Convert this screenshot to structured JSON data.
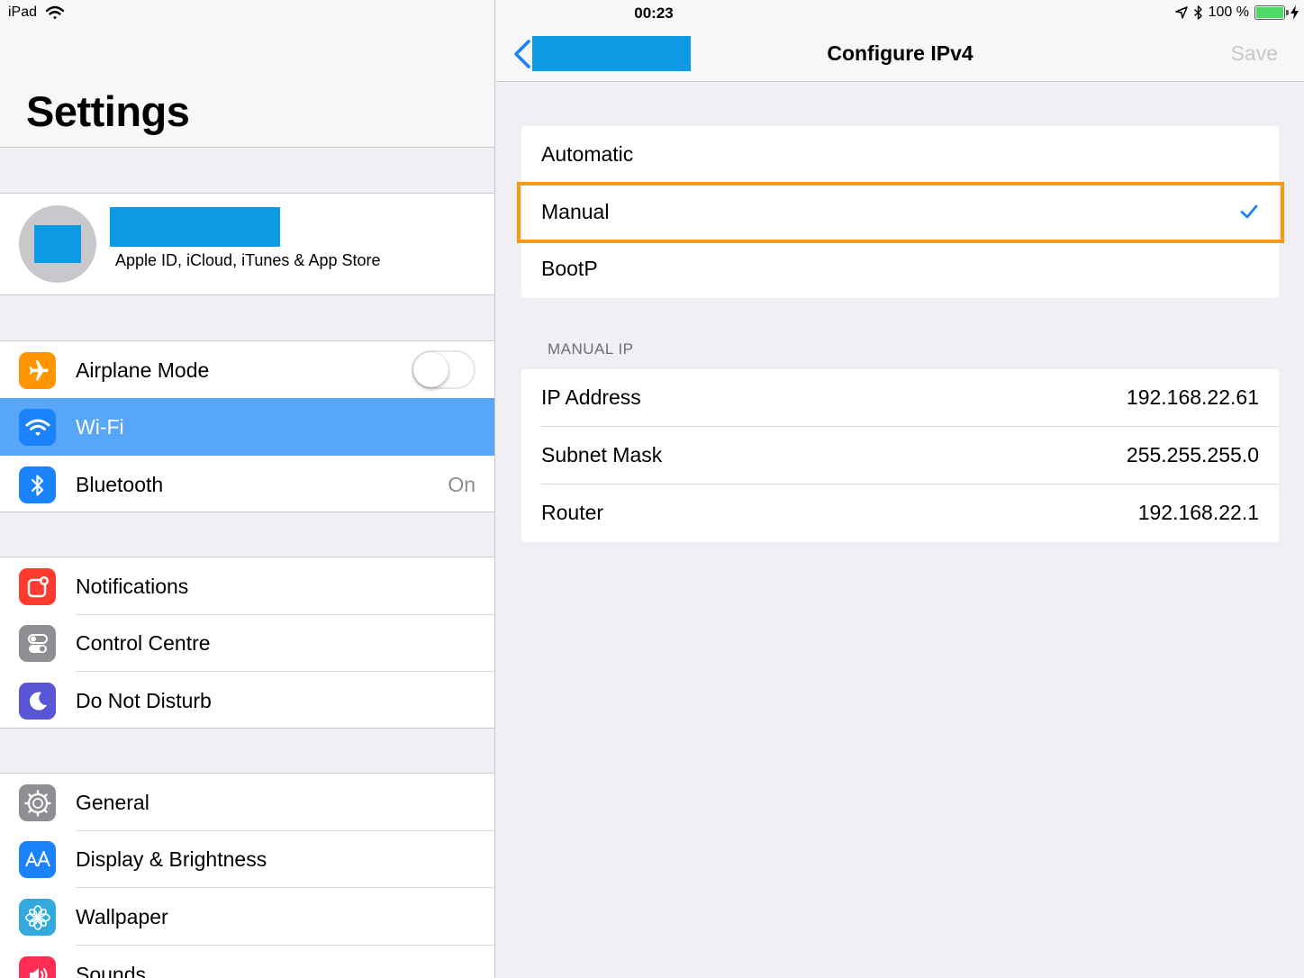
{
  "status_bar": {
    "device": "iPad",
    "time": "00:23",
    "battery": "100 %"
  },
  "sidebar": {
    "title": "Settings",
    "profile": {
      "subtitle": "Apple ID, iCloud, iTunes & App Store"
    },
    "items": [
      {
        "label": "Airplane Mode",
        "icon": "airplane-icon",
        "color": "#ff9500",
        "toggle": false
      },
      {
        "label": "Wi-Fi",
        "icon": "wifi-icon",
        "color": "#1a82fb",
        "selected": true
      },
      {
        "label": "Bluetooth",
        "icon": "bluetooth-icon",
        "color": "#1a82fb",
        "value": "On"
      },
      {
        "label": "Notifications",
        "icon": "notifications-icon",
        "color": "#ff3b30"
      },
      {
        "label": "Control Centre",
        "icon": "control-centre-icon",
        "color": "#8e8e93"
      },
      {
        "label": "Do Not Disturb",
        "icon": "moon-icon",
        "color": "#5856d6"
      },
      {
        "label": "General",
        "icon": "gear-icon",
        "color": "#8e8e93"
      },
      {
        "label": "Display & Brightness",
        "icon": "display-icon",
        "color": "#1a82fb"
      },
      {
        "label": "Wallpaper",
        "icon": "wallpaper-icon",
        "color": "#34aadc"
      },
      {
        "label": "Sounds",
        "icon": "sounds-icon",
        "color": "#ff2d55"
      }
    ]
  },
  "detail": {
    "nav_title": "Configure IPv4",
    "save_label": "Save",
    "options": [
      "Automatic",
      "Manual",
      "BootP"
    ],
    "selected_option": "Manual",
    "manual_section_header": "MANUAL IP",
    "fields": [
      {
        "label": "IP Address",
        "value": "192.168.22.61"
      },
      {
        "label": "Subnet Mask",
        "value": "255.255.255.0"
      },
      {
        "label": "Router",
        "value": "192.168.22.1"
      }
    ]
  },
  "colors": {
    "accent": "#1a82fb",
    "selection": "#58a6f8",
    "highlight_box": "#f39a1d",
    "redaction": "#0b9ae3"
  }
}
